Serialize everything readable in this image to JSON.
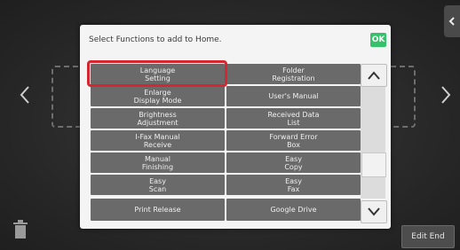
{
  "dialog": {
    "title": "Select Functions to add to Home.",
    "ok_label": "OK"
  },
  "functions": [
    [
      "Language\nSetting",
      "Folder\nRegistration"
    ],
    [
      "Enlarge\nDisplay Mode",
      "User's Manual"
    ],
    [
      "Brightness\nAdjustment",
      "Received Data\nList"
    ],
    [
      "I-Fax Manual\nReceive",
      "Forward Error\nBox"
    ],
    [
      "Manual\nFinishing",
      "Easy\nCopy"
    ],
    [
      "Easy\nScan",
      "Easy\nFax"
    ],
    [
      "Print Release",
      "Google Drive"
    ]
  ],
  "footer": {
    "edit_end_label": "Edit End"
  },
  "colors": {
    "ok": "#36c26a",
    "highlight": "#d6262f",
    "cell": "#6a6a6a"
  },
  "icons": [
    "chevron-left-icon",
    "chevron-right-icon",
    "trash-icon",
    "chevron-up-icon",
    "chevron-down-icon",
    "collapse-tab-icon"
  ]
}
